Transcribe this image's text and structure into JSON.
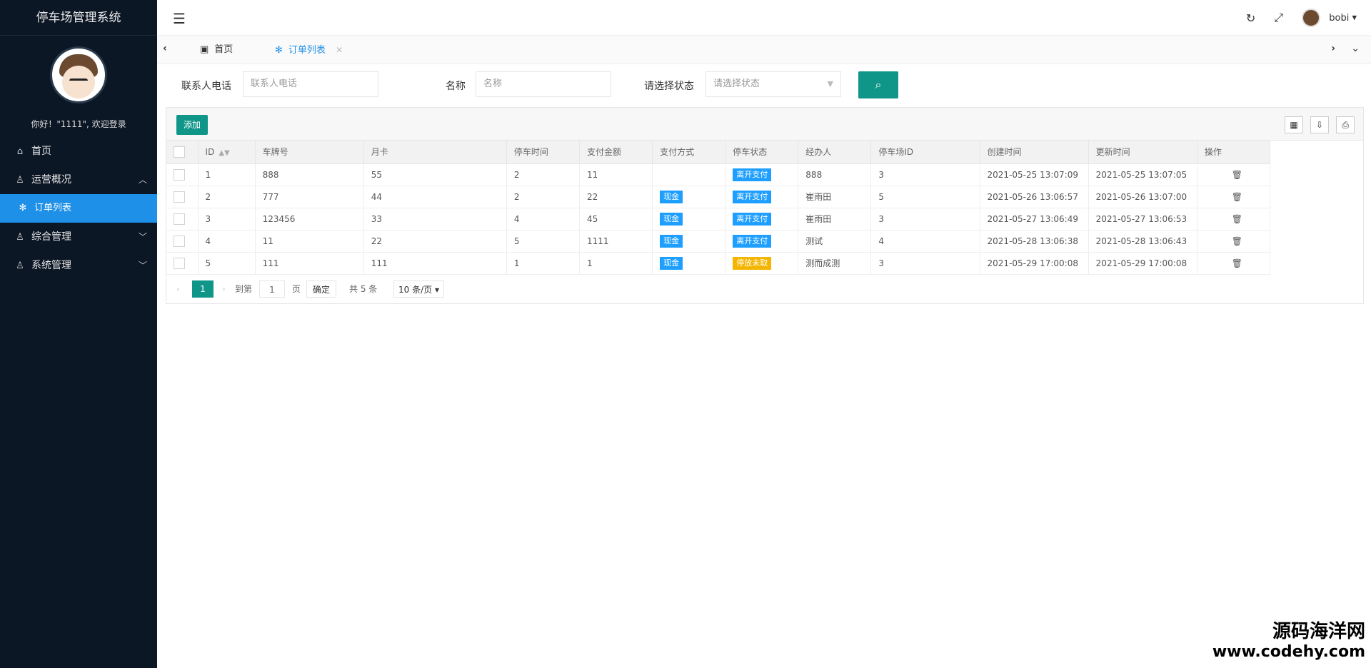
{
  "app": {
    "title": "停车场管理系统",
    "welcome": "你好！\"1111\", 欢迎登录"
  },
  "nav": [
    {
      "label": "首页",
      "icon": "home-icon"
    },
    {
      "label": "运营概况",
      "icon": "user-icon",
      "expanded": true
    },
    {
      "label": "订单列表",
      "icon": "leaf-icon",
      "active": true
    },
    {
      "label": "综合管理",
      "icon": "user-icon"
    },
    {
      "label": "系统管理",
      "icon": "user-icon"
    }
  ],
  "header": {
    "username": "bobi"
  },
  "tabs": [
    {
      "label": "首页"
    },
    {
      "label": "订单列表"
    }
  ],
  "search": {
    "phone_label": "联系人电话",
    "phone_placeholder": "联系人电话",
    "name_label": "名称",
    "name_placeholder": "名称",
    "status_label": "请选择状态",
    "status_placeholder": "请选择状态"
  },
  "toolbar": {
    "add_label": "添加"
  },
  "table": {
    "columns": [
      "ID",
      "车牌号",
      "月卡",
      "停车时间",
      "支付金额",
      "支付方式",
      "停车状态",
      "经办人",
      "停车场ID",
      "创建时间",
      "更新时间",
      "操作"
    ],
    "rows": [
      {
        "id": "1",
        "plate": "888",
        "card": "55",
        "time": "2",
        "amount": "11",
        "pay": "",
        "status": "离开支付",
        "status_type": "info",
        "handler": "888",
        "lot": "3",
        "created": "2021-05-25 13:07:09",
        "updated": "2021-05-25 13:07:05"
      },
      {
        "id": "2",
        "plate": "777",
        "card": "44",
        "time": "2",
        "amount": "22",
        "pay": "现金",
        "status": "离开支付",
        "status_type": "info",
        "handler": "崔雨田",
        "lot": "5",
        "created": "2021-05-26 13:06:57",
        "updated": "2021-05-26 13:07:00"
      },
      {
        "id": "3",
        "plate": "123456",
        "card": "33",
        "time": "4",
        "amount": "45",
        "pay": "现金",
        "status": "离开支付",
        "status_type": "info",
        "handler": "崔雨田",
        "lot": "3",
        "created": "2021-05-27 13:06:49",
        "updated": "2021-05-27 13:06:53"
      },
      {
        "id": "4",
        "plate": "11",
        "card": "22",
        "time": "5",
        "amount": "1111",
        "pay": "现金",
        "status": "离开支付",
        "status_type": "info",
        "handler": "测试",
        "lot": "4",
        "created": "2021-05-28 13:06:38",
        "updated": "2021-05-28 13:06:43"
      },
      {
        "id": "5",
        "plate": "111",
        "card": "111",
        "time": "1",
        "amount": "1",
        "pay": "现金",
        "status": "停放未取",
        "status_type": "warn",
        "handler": "测而成测",
        "lot": "3",
        "created": "2021-05-29 17:00:08",
        "updated": "2021-05-29 17:00:08"
      }
    ]
  },
  "pager": {
    "current": "1",
    "goto_label": "到第",
    "goto_value": "1",
    "page_label": "页",
    "ok_label": "确定",
    "total_label": "共 5 条",
    "size_label": "10 条/页"
  },
  "watermark": {
    "cn": "源码海洋网",
    "en": "www.codehy.com"
  }
}
